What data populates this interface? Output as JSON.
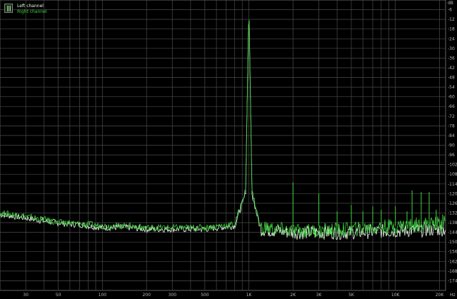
{
  "chart_data": {
    "type": "line",
    "title": "",
    "xlabel": "",
    "ylabel": "",
    "x_scale": "log",
    "xlim": [
      20,
      22000
    ],
    "ylim": [
      -180,
      0
    ],
    "grid": true,
    "legend_position": "top-left",
    "x_tick_labels": [
      {
        "f": 30,
        "label": "30"
      },
      {
        "f": 50,
        "label": "50"
      },
      {
        "f": 100,
        "label": "100"
      },
      {
        "f": 200,
        "label": "200"
      },
      {
        "f": 300,
        "label": "300"
      },
      {
        "f": 500,
        "label": "500"
      },
      {
        "f": 1000,
        "label": "1K"
      },
      {
        "f": 2000,
        "label": "2K"
      },
      {
        "f": 3000,
        "label": "3K"
      },
      {
        "f": 5000,
        "label": "5K"
      },
      {
        "f": 10000,
        "label": "10K"
      },
      {
        "f": 20000,
        "label": "20K"
      }
    ],
    "x_unit": "Hz",
    "y_ticks": [
      -6,
      -12,
      -18,
      -24,
      -30,
      -36,
      -42,
      -48,
      -54,
      -60,
      -66,
      -72,
      -78,
      -84,
      -90,
      -96,
      -102,
      -108,
      -114,
      -120,
      -126,
      -132,
      -138,
      -144,
      -150,
      -156,
      -162,
      -168,
      -174
    ],
    "y_unit": "dB",
    "series": [
      {
        "name": "Left channel",
        "color": "#e6ffe6",
        "points": [
          [
            20,
            -133
          ],
          [
            25,
            -134
          ],
          [
            30,
            -135
          ],
          [
            40,
            -137
          ],
          [
            50,
            -138
          ],
          [
            60,
            -139
          ],
          [
            70,
            -139
          ],
          [
            80,
            -140
          ],
          [
            100,
            -141
          ],
          [
            150,
            -141
          ],
          [
            200,
            -142
          ],
          [
            300,
            -142
          ],
          [
            500,
            -142
          ],
          [
            800,
            -140
          ],
          [
            950,
            -120
          ],
          [
            1000,
            -1
          ],
          [
            1050,
            -120
          ],
          [
            1200,
            -142
          ],
          [
            2000,
            -144
          ],
          [
            3000,
            -144
          ],
          [
            5000,
            -144
          ],
          [
            10000,
            -143
          ],
          [
            22000,
            -142
          ]
        ]
      },
      {
        "name": "Right channel",
        "color": "#3fd43f",
        "points": [
          [
            20,
            -132
          ],
          [
            25,
            -133
          ],
          [
            30,
            -134
          ],
          [
            40,
            -136
          ],
          [
            50,
            -138
          ],
          [
            60,
            -138
          ],
          [
            70,
            -139
          ],
          [
            80,
            -139
          ],
          [
            100,
            -140
          ],
          [
            150,
            -140
          ],
          [
            200,
            -141
          ],
          [
            300,
            -141
          ],
          [
            500,
            -141
          ],
          [
            800,
            -139
          ],
          [
            950,
            -118
          ],
          [
            1000,
            -1
          ],
          [
            1050,
            -118
          ],
          [
            1200,
            -141
          ],
          [
            2000,
            -143
          ],
          [
            3000,
            -143
          ],
          [
            5000,
            -142
          ],
          [
            10000,
            -140
          ],
          [
            22000,
            -138
          ]
        ]
      }
    ],
    "peaks": [
      {
        "f": 2000,
        "db": -113
      },
      {
        "f": 3000,
        "db": -120
      },
      {
        "f": 4000,
        "db": -131
      },
      {
        "f": 5000,
        "db": -127
      },
      {
        "f": 6000,
        "db": -131
      },
      {
        "f": 7000,
        "db": -128
      },
      {
        "f": 8000,
        "db": -130
      },
      {
        "f": 10000,
        "db": -128
      },
      {
        "f": 12000,
        "db": -131
      },
      {
        "f": 13000,
        "db": -118
      },
      {
        "f": 15000,
        "db": -119
      },
      {
        "f": 17000,
        "db": -119
      },
      {
        "f": 19000,
        "db": -130
      },
      {
        "f": 21000,
        "db": -133
      }
    ]
  },
  "legend": {
    "left": "Left channel",
    "right": "Right channel"
  },
  "colors": {
    "background": "#000000",
    "grid": "#4a4a4a",
    "tick_text": "#b8b8b8",
    "left": "#e6ffe6",
    "right": "#3fd43f"
  }
}
